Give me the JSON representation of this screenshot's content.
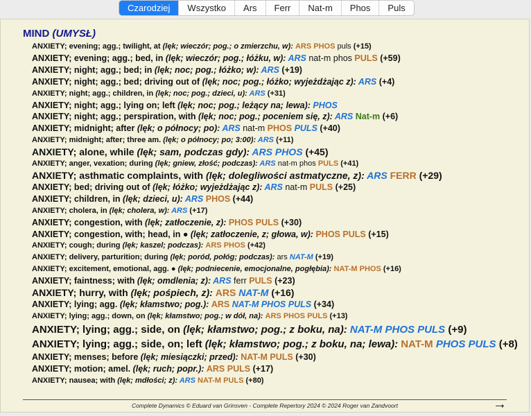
{
  "tabs": [
    {
      "label": "Czarodziej",
      "active": true
    },
    {
      "label": "Wszystko"
    },
    {
      "label": "Ars"
    },
    {
      "label": "Ferr"
    },
    {
      "label": "Nat-m"
    },
    {
      "label": "Phos"
    },
    {
      "label": "Puls"
    }
  ],
  "heading": {
    "main": "MIND",
    "sub": "(UMYSŁ)"
  },
  "rubrics": [
    {
      "size": "s11",
      "text": "ANXIETY; evening; agg.; twilight, at",
      "trans": "(lęk; wieczór; pog.; o zmierzchu, w):",
      "remedies": [
        [
          "ARS",
          "orange",
          "r3"
        ],
        [
          "PHOS",
          "orange",
          "r3"
        ],
        [
          "puls",
          "",
          "r1"
        ]
      ],
      "count": "(+15)"
    },
    {
      "size": "s12",
      "text": "ANXIETY; evening; agg.; bed, in",
      "trans": "(lęk; wieczór; pog.; łóżku, w):",
      "remedies": [
        [
          "ARS",
          "blue",
          "r2"
        ],
        [
          "nat-m",
          "",
          "r1"
        ],
        [
          "phos",
          "",
          "r1"
        ],
        [
          "PULS",
          "orange",
          "r3"
        ]
      ],
      "count": "(+59)"
    },
    {
      "size": "s12",
      "text": "ANXIETY; night; agg.; bed; in",
      "trans": "(lęk; noc; pog.; łóżko; w):",
      "remedies": [
        [
          "ARS",
          "blue",
          "r2"
        ]
      ],
      "count": "(+19)"
    },
    {
      "size": "s12",
      "text": "ANXIETY; night; agg.; bed; driving out of",
      "trans": "(lęk; noc; pog.; łóżko; wyjeżdżając z):",
      "remedies": [
        [
          "ARS",
          "blue",
          "r2"
        ]
      ],
      "count": "(+4)"
    },
    {
      "size": "s11",
      "text": "ANXIETY; night; agg.; children, in",
      "trans": "(lęk; noc; pog.; dzieci, u):",
      "remedies": [
        [
          "ARS",
          "blue",
          "r2"
        ]
      ],
      "count": "(+31)"
    },
    {
      "size": "s12",
      "text": "ANXIETY; night; agg.; lying on; left",
      "trans": "(lęk; noc; pog.; leżący na; lewa):",
      "remedies": [
        [
          "PHOS",
          "blue",
          "r2"
        ]
      ],
      "count": ""
    },
    {
      "size": "s12",
      "text": "ANXIETY; night; agg.; perspiration, with",
      "trans": "(lęk; noc; pog.; poceniem się, z):",
      "remedies": [
        [
          "ARS",
          "blue",
          "r2"
        ],
        [
          "Nat-m",
          "green",
          "r3"
        ]
      ],
      "count": "(+6)"
    },
    {
      "size": "s12",
      "text": "ANXIETY; midnight; after",
      "trans": "(lęk; o północy; po):",
      "remedies": [
        [
          "ARS",
          "blue",
          "r2"
        ],
        [
          "nat-m",
          "",
          "r1"
        ],
        [
          "PHOS",
          "orange",
          "r3"
        ],
        [
          "PULS",
          "blue",
          "r2"
        ]
      ],
      "count": "(+40)"
    },
    {
      "size": "s11",
      "text": "ANXIETY; midnight; after; three am.",
      "trans": "(lęk; o północy; po; 3:00):",
      "remedies": [
        [
          "ARS",
          "blue",
          "r2"
        ]
      ],
      "count": "(+11)"
    },
    {
      "size": "s13",
      "text": "ANXIETY; alone, while",
      "trans": "(lęk; sam, podczas gdy):",
      "remedies": [
        [
          "ARS",
          "blue",
          "r2"
        ],
        [
          "PHOS",
          "blue",
          "r2"
        ]
      ],
      "count": "(+45)"
    },
    {
      "size": "s11",
      "text": "ANXIETY; anger, vexation; during",
      "trans": "(lęk; gniew, złość; podczas):",
      "remedies": [
        [
          "ARS",
          "blue",
          "r2"
        ],
        [
          "nat-m",
          "",
          "r1"
        ],
        [
          "phos",
          "",
          "r1"
        ],
        [
          "PULS",
          "orange",
          "r3"
        ]
      ],
      "count": "(+41)"
    },
    {
      "size": "s13",
      "text": "ANXIETY; asthmatic complaints, with",
      "trans": "(lęk; dolegliwości astmatyczne, z):",
      "remedies": [
        [
          "ARS",
          "blue",
          "r2"
        ],
        [
          "FERR",
          "orange",
          "r3"
        ]
      ],
      "count": "(+29)"
    },
    {
      "size": "s12",
      "text": "ANXIETY; bed; driving out of",
      "trans": "(lęk; łóżko; wyjeżdżając z):",
      "remedies": [
        [
          "ARS",
          "blue",
          "r2"
        ],
        [
          "nat-m",
          "",
          "r1"
        ],
        [
          "PULS",
          "orange",
          "r3"
        ]
      ],
      "count": "(+25)"
    },
    {
      "size": "s12",
      "text": "ANXIETY; children, in",
      "trans": "(lęk; dzieci, u):",
      "remedies": [
        [
          "ARS",
          "blue",
          "r2"
        ],
        [
          "PHOS",
          "orange",
          "r3"
        ]
      ],
      "count": "(+44)"
    },
    {
      "size": "s11",
      "text": "ANXIETY; cholera, in",
      "trans": "(lęk; cholera, w):",
      "remedies": [
        [
          "ARS",
          "blue",
          "r2"
        ]
      ],
      "count": "(+17)"
    },
    {
      "size": "s12",
      "text": "ANXIETY; congestion, with",
      "trans": "(lęk; zatłoczenie, z):",
      "remedies": [
        [
          "PHOS",
          "orange",
          "r3"
        ],
        [
          "PULS",
          "orange",
          "r3"
        ]
      ],
      "count": "(+30)"
    },
    {
      "size": "s12",
      "text": "ANXIETY; congestion, with; head, in ●",
      "trans": "(lęk; zatłoczenie, z; głowa, w):",
      "remedies": [
        [
          "PHOS",
          "orange",
          "r3"
        ],
        [
          "PULS",
          "orange",
          "r3"
        ]
      ],
      "count": "(+15)"
    },
    {
      "size": "s11",
      "text": "ANXIETY; cough; during",
      "trans": "(lęk; kaszel; podczas):",
      "remedies": [
        [
          "ARS",
          "orange",
          "r3"
        ],
        [
          "PHOS",
          "orange",
          "r3"
        ]
      ],
      "count": "(+42)"
    },
    {
      "size": "s11",
      "text": "ANXIETY; delivery, parturition; during",
      "trans": "(lęk; poród, połóg; podczas):",
      "remedies": [
        [
          "ars",
          "",
          "r1"
        ],
        [
          "NAT-M",
          "blue",
          "r2"
        ]
      ],
      "count": "(+19)"
    },
    {
      "size": "s11",
      "text": "ANXIETY; excitement, emotional, agg. ●",
      "trans": "(lęk; podniecenie, emocjonalne, pogłębia):",
      "remedies": [
        [
          "NAT-M",
          "orange",
          "r3"
        ],
        [
          "PHOS",
          "orange",
          "r3"
        ]
      ],
      "count": "(+16)"
    },
    {
      "size": "s12",
      "text": "ANXIETY; faintness; with",
      "trans": "(lęk; omdlenia; z):",
      "remedies": [
        [
          "ARS",
          "blue",
          "r2"
        ],
        [
          "ferr",
          "",
          "r1"
        ],
        [
          "PULS",
          "orange",
          "r3"
        ]
      ],
      "count": "(+23)"
    },
    {
      "size": "s13",
      "text": "ANXIETY; hurry, with",
      "trans": "(lęk; pośpiech, z):",
      "remedies": [
        [
          "ARS",
          "orange",
          "r3"
        ],
        [
          "NAT-M",
          "blue",
          "r2"
        ]
      ],
      "count": "(+16)"
    },
    {
      "size": "s12",
      "text": "ANXIETY; lying; agg.",
      "trans": "(lęk; kłamstwo; pog.):",
      "remedies": [
        [
          "ARS",
          "orange",
          "r3"
        ],
        [
          "NAT-M",
          "blue",
          "r2"
        ],
        [
          "PHOS",
          "blue",
          "r2"
        ],
        [
          "PULS",
          "blue",
          "r2"
        ]
      ],
      "count": "(+34)"
    },
    {
      "size": "s11",
      "text": "ANXIETY; lying; agg.; down, on",
      "trans": "(lęk; kłamstwo; pog.; w dół, na):",
      "remedies": [
        [
          "ARS",
          "orange",
          "r3"
        ],
        [
          "PHOS",
          "orange",
          "r3"
        ],
        [
          "PULS",
          "orange",
          "r3"
        ]
      ],
      "count": "(+13)"
    },
    {
      "size": "s14",
      "text": "ANXIETY; lying; agg.; side, on",
      "trans": "(lęk; kłamstwo; pog.; z boku, na):",
      "remedies": [
        [
          "NAT-M",
          "blue",
          "r2"
        ],
        [
          "PHOS",
          "blue",
          "r2"
        ],
        [
          "PULS",
          "blue",
          "r2"
        ]
      ],
      "count": "(+9)"
    },
    {
      "size": "s14",
      "text": "ANXIETY; lying; agg.; side, on; left",
      "trans": "(lęk; kłamstwo; pog.; z boku, na; lewa):",
      "remedies": [
        [
          "NAT-M",
          "orange",
          "r3"
        ],
        [
          "PHOS",
          "blue",
          "r2"
        ],
        [
          "PULS",
          "blue",
          "r2"
        ]
      ],
      "count": "(+8)"
    },
    {
      "size": "s12",
      "text": "ANXIETY; menses; before",
      "trans": "(lęk; miesiączki; przed):",
      "remedies": [
        [
          "NAT-M",
          "orange",
          "r3"
        ],
        [
          "PULS",
          "orange",
          "r3"
        ]
      ],
      "count": "(+30)"
    },
    {
      "size": "s12",
      "text": "ANXIETY; motion; amel.",
      "trans": "(lęk; ruch; popr.):",
      "remedies": [
        [
          "ARS",
          "orange",
          "r3"
        ],
        [
          "PULS",
          "orange",
          "r3"
        ]
      ],
      "count": "(+17)"
    },
    {
      "size": "s11",
      "text": "ANXIETY; nausea; with",
      "trans": "(lęk; mdłości; z):",
      "remedies": [
        [
          "ARS",
          "blue",
          "r2"
        ],
        [
          "NAT-M",
          "orange",
          "r3"
        ],
        [
          "PULS",
          "orange",
          "r3"
        ]
      ],
      "count": "(+80)"
    }
  ],
  "footer": "Complete Dynamics © Eduard van Grinsven   -   Complete Repertory 2024 © 2024 Roger van Zandvoort",
  "arrow": "→"
}
